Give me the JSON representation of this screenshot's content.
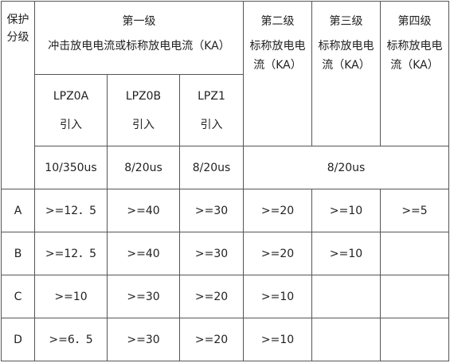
{
  "header": {
    "grade_line1": "保护",
    "grade_line2": "分级",
    "level1_title": "第一级",
    "level1_subtitle": "冲击放电电流或标称放电电流（KA）",
    "level2_title": "第二级",
    "level2_line1": "标称放电电",
    "level2_line2": "流（KA）",
    "level3_title": "第三级",
    "level3_line1": "标称放电电",
    "level3_line2": "流（KA）",
    "level4_title": "第四级",
    "level4_line1": "标称放电电",
    "level4_line2": "流（KA）"
  },
  "zones": [
    {
      "name": "LPZ0A",
      "note": "引入"
    },
    {
      "name": "LPZ0B",
      "note": "引入"
    },
    {
      "name": "LPZ1",
      "note": "引入"
    }
  ],
  "waveforms": {
    "lpz0a": "10/350us",
    "lpz0b": "8/20us",
    "lpz1": "8/20us",
    "levels_2_4": "8/20us"
  },
  "rows": [
    {
      "grade": "A",
      "lpz0a": ">=12．5",
      "lpz0b": ">=40",
      "lpz1": ">=30",
      "level2": ">=20",
      "level3": ">=10",
      "level4": ">=5"
    },
    {
      "grade": "B",
      "lpz0a": ">=12．5",
      "lpz0b": ">=40",
      "lpz1": ">=30",
      "level2": ">=20",
      "level3": ">=10",
      "level4": ""
    },
    {
      "grade": "C",
      "lpz0a": ">=10",
      "lpz0b": ">=30",
      "lpz1": ">=20",
      "level2": ">=10",
      "level3": "",
      "level4": ""
    },
    {
      "grade": "D",
      "lpz0a": ">=6．5",
      "lpz0b": ">=30",
      "lpz1": ">=20",
      "level2": ">=10",
      "level3": "",
      "level4": ""
    }
  ]
}
